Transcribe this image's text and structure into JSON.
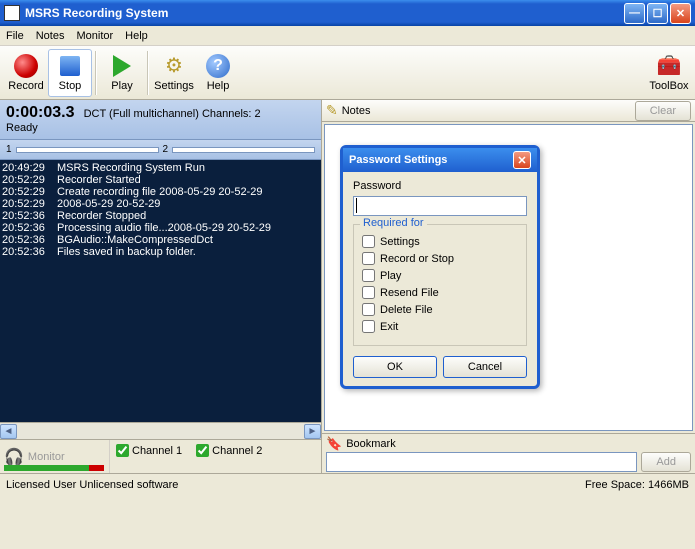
{
  "window": {
    "title": "MSRS Recording System"
  },
  "menu": {
    "file": "File",
    "notes": "Notes",
    "monitor": "Monitor",
    "help": "Help"
  },
  "toolbar": {
    "record": "Record",
    "stop": "Stop",
    "play": "Play",
    "settings": "Settings",
    "help": "Help",
    "toolbox": "ToolBox"
  },
  "status": {
    "time": "0:00:03.3",
    "mode": "DCT (Full multichannel) Channels: 2",
    "ready": "Ready",
    "ch1": "1",
    "ch2": "2"
  },
  "log": [
    {
      "t": "20:49:29",
      "m": "MSRS Recording System Run"
    },
    {
      "t": "20:52:29",
      "m": "Recorder Started"
    },
    {
      "t": "20:52:29",
      "m": "Create recording file 2008-05-29 20-52-29"
    },
    {
      "t": "20:52:29",
      "m": "2008-05-29 20-52-29"
    },
    {
      "t": "20:52:36",
      "m": "Recorder Stopped"
    },
    {
      "t": "20:52:36",
      "m": "Processing audio file...2008-05-29 20-52-29"
    },
    {
      "t": "20:52:36",
      "m": "BGAudio::MakeCompressedDct"
    },
    {
      "t": "20:52:36",
      "m": "Files saved in backup folder."
    }
  ],
  "monitor": {
    "label": "Monitor",
    "ch1": "Channel 1",
    "ch2": "Channel 2"
  },
  "notes": {
    "header": "Notes",
    "clear": "Clear"
  },
  "bookmark": {
    "label": "Bookmark",
    "add": "Add",
    "value": ""
  },
  "statusbar": {
    "user": "Licensed User Unlicensed software",
    "space": "Free Space: 1466MB"
  },
  "dialog": {
    "title": "Password Settings",
    "password_label": "Password",
    "password_value": "",
    "legend": "Required for",
    "opts": {
      "settings": "Settings",
      "record_stop": "Record or Stop",
      "play": "Play",
      "resend": "Resend File",
      "delete": "Delete File",
      "exit": "Exit"
    },
    "ok": "OK",
    "cancel": "Cancel"
  }
}
